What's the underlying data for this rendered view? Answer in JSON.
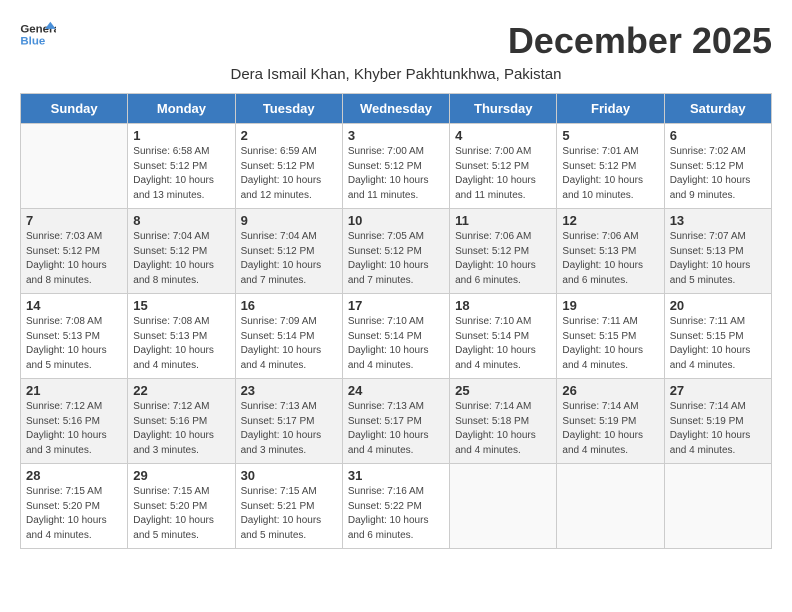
{
  "header": {
    "logo_line1": "General",
    "logo_line2": "Blue",
    "month_title": "December 2025",
    "subtitle": "Dera Ismail Khan, Khyber Pakhtunkhwa, Pakistan"
  },
  "days_of_week": [
    "Sunday",
    "Monday",
    "Tuesday",
    "Wednesday",
    "Thursday",
    "Friday",
    "Saturday"
  ],
  "weeks": [
    [
      {
        "day": "",
        "info": ""
      },
      {
        "day": "1",
        "info": "Sunrise: 6:58 AM\nSunset: 5:12 PM\nDaylight: 10 hours\nand 13 minutes."
      },
      {
        "day": "2",
        "info": "Sunrise: 6:59 AM\nSunset: 5:12 PM\nDaylight: 10 hours\nand 12 minutes."
      },
      {
        "day": "3",
        "info": "Sunrise: 7:00 AM\nSunset: 5:12 PM\nDaylight: 10 hours\nand 11 minutes."
      },
      {
        "day": "4",
        "info": "Sunrise: 7:00 AM\nSunset: 5:12 PM\nDaylight: 10 hours\nand 11 minutes."
      },
      {
        "day": "5",
        "info": "Sunrise: 7:01 AM\nSunset: 5:12 PM\nDaylight: 10 hours\nand 10 minutes."
      },
      {
        "day": "6",
        "info": "Sunrise: 7:02 AM\nSunset: 5:12 PM\nDaylight: 10 hours\nand 9 minutes."
      }
    ],
    [
      {
        "day": "7",
        "info": "Sunrise: 7:03 AM\nSunset: 5:12 PM\nDaylight: 10 hours\nand 8 minutes."
      },
      {
        "day": "8",
        "info": "Sunrise: 7:04 AM\nSunset: 5:12 PM\nDaylight: 10 hours\nand 8 minutes."
      },
      {
        "day": "9",
        "info": "Sunrise: 7:04 AM\nSunset: 5:12 PM\nDaylight: 10 hours\nand 7 minutes."
      },
      {
        "day": "10",
        "info": "Sunrise: 7:05 AM\nSunset: 5:12 PM\nDaylight: 10 hours\nand 7 minutes."
      },
      {
        "day": "11",
        "info": "Sunrise: 7:06 AM\nSunset: 5:12 PM\nDaylight: 10 hours\nand 6 minutes."
      },
      {
        "day": "12",
        "info": "Sunrise: 7:06 AM\nSunset: 5:13 PM\nDaylight: 10 hours\nand 6 minutes."
      },
      {
        "day": "13",
        "info": "Sunrise: 7:07 AM\nSunset: 5:13 PM\nDaylight: 10 hours\nand 5 minutes."
      }
    ],
    [
      {
        "day": "14",
        "info": "Sunrise: 7:08 AM\nSunset: 5:13 PM\nDaylight: 10 hours\nand 5 minutes."
      },
      {
        "day": "15",
        "info": "Sunrise: 7:08 AM\nSunset: 5:13 PM\nDaylight: 10 hours\nand 4 minutes."
      },
      {
        "day": "16",
        "info": "Sunrise: 7:09 AM\nSunset: 5:14 PM\nDaylight: 10 hours\nand 4 minutes."
      },
      {
        "day": "17",
        "info": "Sunrise: 7:10 AM\nSunset: 5:14 PM\nDaylight: 10 hours\nand 4 minutes."
      },
      {
        "day": "18",
        "info": "Sunrise: 7:10 AM\nSunset: 5:14 PM\nDaylight: 10 hours\nand 4 minutes."
      },
      {
        "day": "19",
        "info": "Sunrise: 7:11 AM\nSunset: 5:15 PM\nDaylight: 10 hours\nand 4 minutes."
      },
      {
        "day": "20",
        "info": "Sunrise: 7:11 AM\nSunset: 5:15 PM\nDaylight: 10 hours\nand 4 minutes."
      }
    ],
    [
      {
        "day": "21",
        "info": "Sunrise: 7:12 AM\nSunset: 5:16 PM\nDaylight: 10 hours\nand 3 minutes."
      },
      {
        "day": "22",
        "info": "Sunrise: 7:12 AM\nSunset: 5:16 PM\nDaylight: 10 hours\nand 3 minutes."
      },
      {
        "day": "23",
        "info": "Sunrise: 7:13 AM\nSunset: 5:17 PM\nDaylight: 10 hours\nand 3 minutes."
      },
      {
        "day": "24",
        "info": "Sunrise: 7:13 AM\nSunset: 5:17 PM\nDaylight: 10 hours\nand 4 minutes."
      },
      {
        "day": "25",
        "info": "Sunrise: 7:14 AM\nSunset: 5:18 PM\nDaylight: 10 hours\nand 4 minutes."
      },
      {
        "day": "26",
        "info": "Sunrise: 7:14 AM\nSunset: 5:19 PM\nDaylight: 10 hours\nand 4 minutes."
      },
      {
        "day": "27",
        "info": "Sunrise: 7:14 AM\nSunset: 5:19 PM\nDaylight: 10 hours\nand 4 minutes."
      }
    ],
    [
      {
        "day": "28",
        "info": "Sunrise: 7:15 AM\nSunset: 5:20 PM\nDaylight: 10 hours\nand 4 minutes."
      },
      {
        "day": "29",
        "info": "Sunrise: 7:15 AM\nSunset: 5:20 PM\nDaylight: 10 hours\nand 5 minutes."
      },
      {
        "day": "30",
        "info": "Sunrise: 7:15 AM\nSunset: 5:21 PM\nDaylight: 10 hours\nand 5 minutes."
      },
      {
        "day": "31",
        "info": "Sunrise: 7:16 AM\nSunset: 5:22 PM\nDaylight: 10 hours\nand 6 minutes."
      },
      {
        "day": "",
        "info": ""
      },
      {
        "day": "",
        "info": ""
      },
      {
        "day": "",
        "info": ""
      }
    ]
  ]
}
